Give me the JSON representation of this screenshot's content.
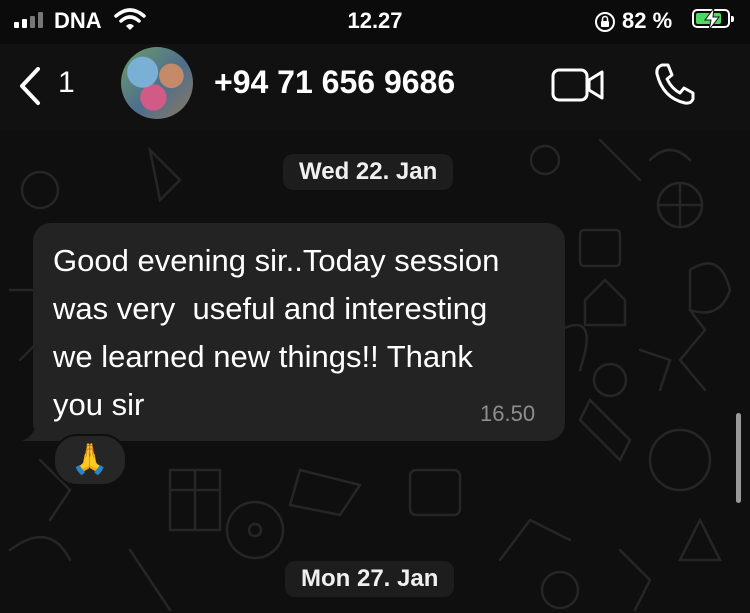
{
  "status_bar": {
    "carrier": "DNA",
    "time": "12.27",
    "battery_percent": "82 %",
    "battery_level": 0.82,
    "icons": [
      "signal-bars-icon",
      "wifi-icon",
      "orientation-lock-icon",
      "battery-charging-icon"
    ]
  },
  "header": {
    "back_count": "1",
    "contact_name": "+94 71 656 9686",
    "icons": [
      "back-chevron-icon",
      "video-call-icon",
      "phone-call-icon"
    ]
  },
  "chat": {
    "dates": [
      "Wed 22. Jan",
      "Mon 27. Jan"
    ],
    "messages": [
      {
        "text_lines": [
          "Good evening sir..Today session",
          "was very  useful and interesting",
          "we learned new things!! Thank",
          "you sir"
        ],
        "time": "16.50",
        "reaction": "🙏"
      }
    ]
  },
  "colors": {
    "background": "#0f0f0f",
    "header": "#111111",
    "bubble": "#232323",
    "battery_fill": "#4cd964",
    "timestamp": "#8e8e8e"
  }
}
